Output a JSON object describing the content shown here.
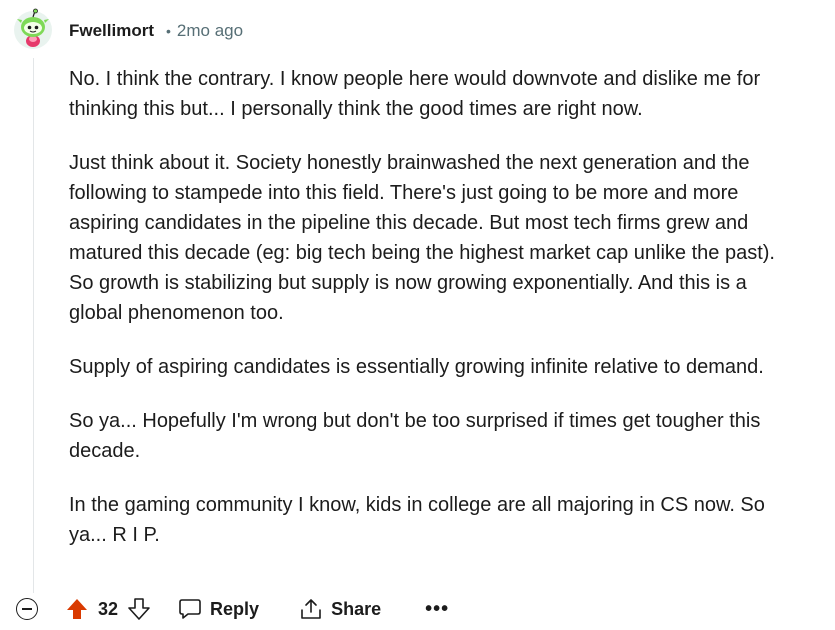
{
  "comment": {
    "author": "Fwellimort",
    "separator": "•",
    "age": "2mo ago",
    "paragraphs": [
      "No. I think the contrary. I know people here would downvote and dislike me for thinking this but... I personally think the good times are right now.",
      "Just think about it. Society honestly brainwashed the next generation and the following to stampede into this field. There's just going to be more and more aspiring candidates in the pipeline this decade. But most tech firms grew and matured this decade (eg: big tech being the highest market cap unlike the past). So growth is stabilizing but supply is now growing exponentially. And this is a global phenomenon too.",
      "Supply of aspiring candidates is essentially growing infinite relative to demand.",
      "So ya... Hopefully I'm wrong but don't be too surprised if times get tougher this decade.",
      "In the gaming community I know, kids in college are all majoring in CS now. So ya... R I P."
    ]
  },
  "actions": {
    "score": "32",
    "reply_label": "Reply",
    "share_label": "Share",
    "more_label": "•••",
    "upvote_color": "#d93a00"
  },
  "icons": {
    "avatar": "snoo-avatar-icon",
    "collapse": "collapse-thread-icon",
    "upvote": "upvote-arrow-icon",
    "downvote": "downvote-arrow-icon",
    "reply": "speech-bubble-icon",
    "share": "share-icon",
    "more": "more-options-icon"
  }
}
